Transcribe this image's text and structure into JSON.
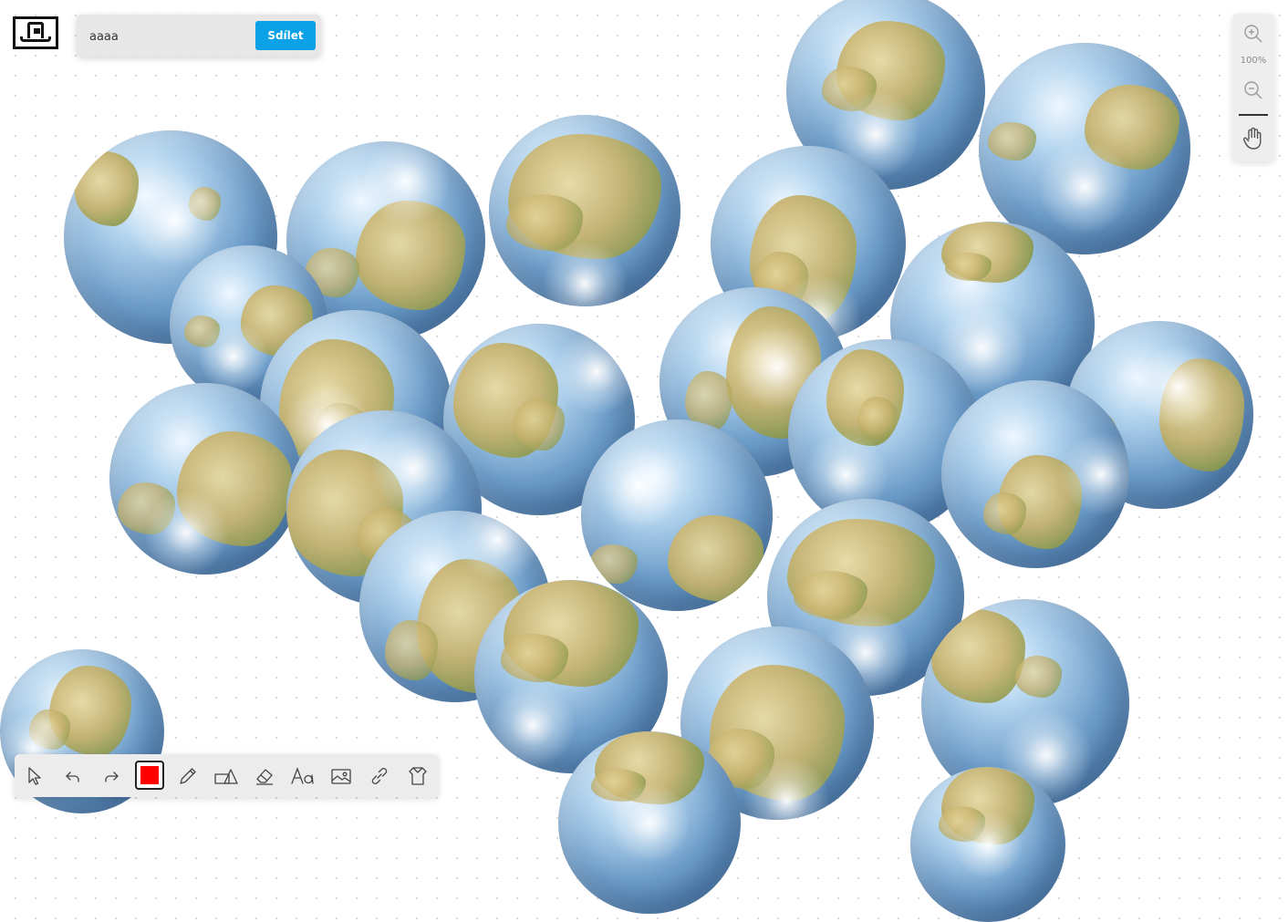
{
  "share": {
    "input_value": "aaaa",
    "button_label": "Sdílet"
  },
  "zoom": {
    "level": "100%"
  },
  "toolbar": {
    "current_color": "#ff0000",
    "tools": [
      "select-icon",
      "undo-icon",
      "redo-icon",
      "color-picker",
      "pen-icon",
      "shapes-icon",
      "eraser-icon",
      "text-icon",
      "image-icon",
      "link-icon",
      "background-icon"
    ]
  },
  "colors": {
    "accent": "#0aa1e6",
    "toolbar_bg": "#ececec",
    "canvas_bg": "#ffffff"
  },
  "canvas": {
    "object_type": "globe-image"
  }
}
